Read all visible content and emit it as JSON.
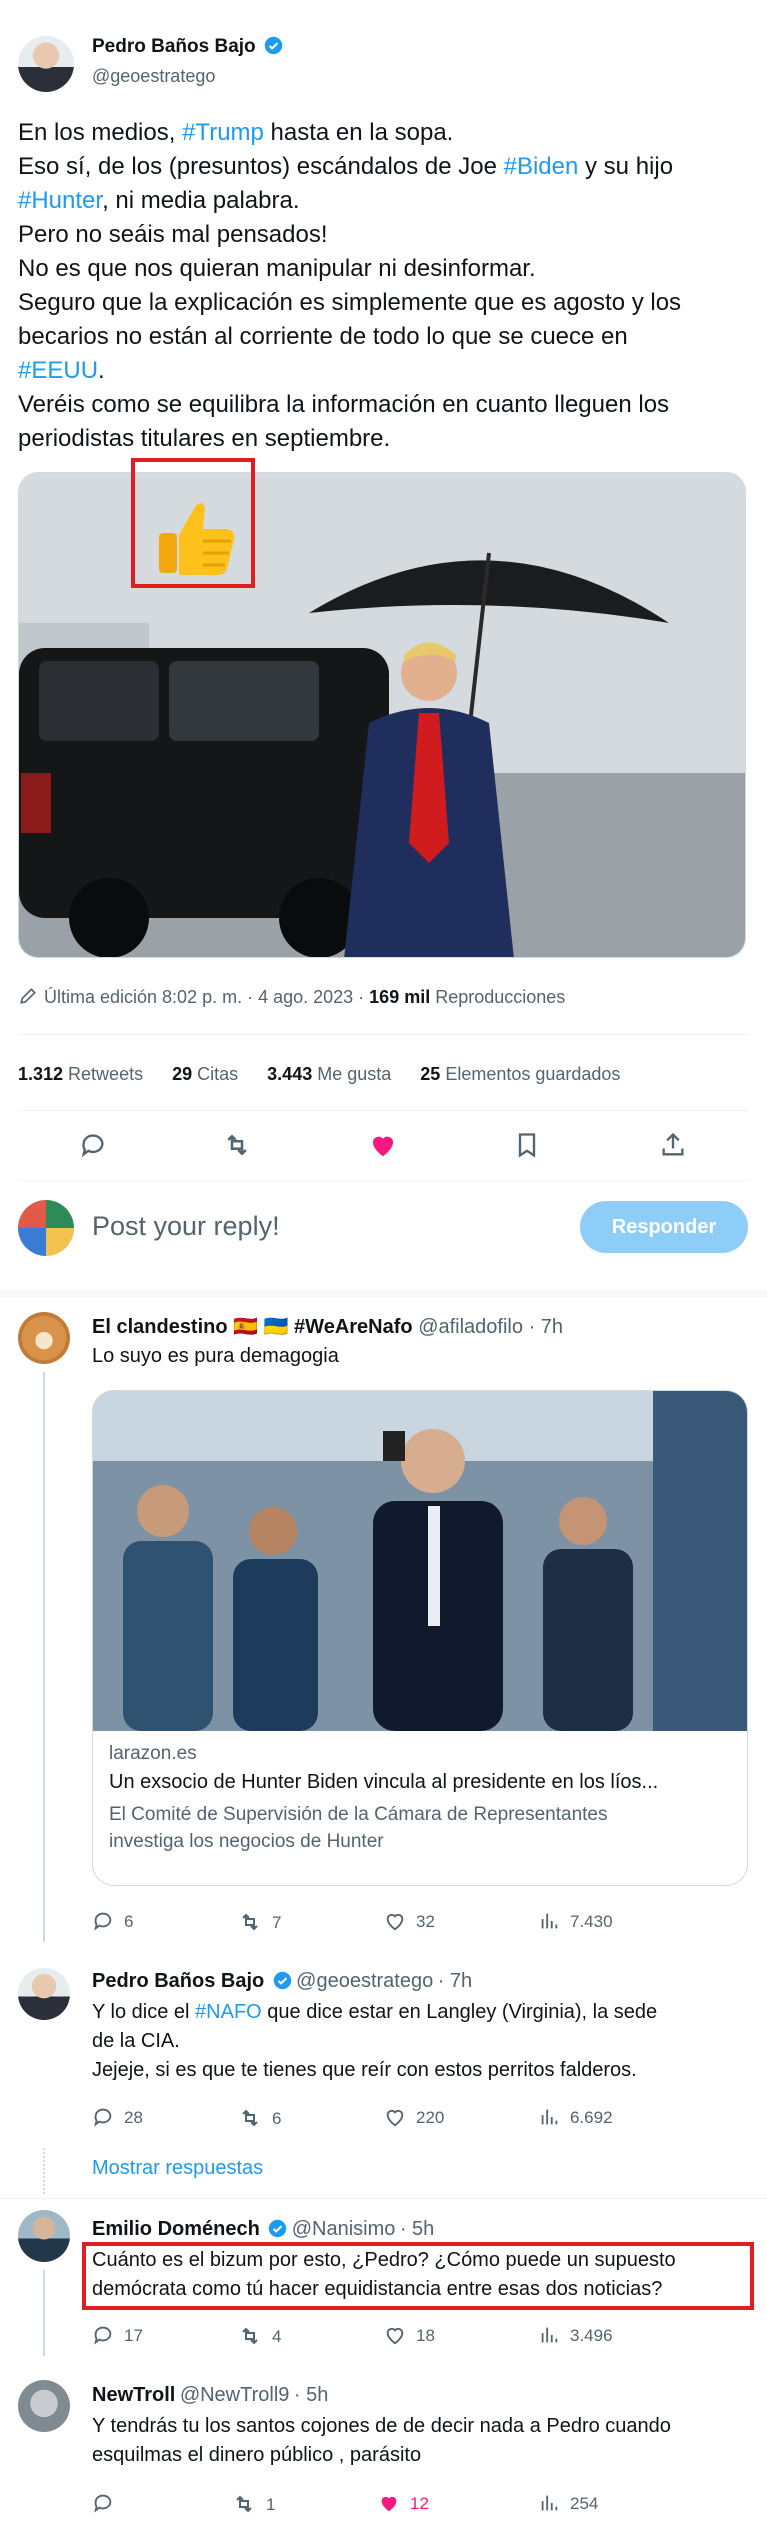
{
  "main_tweet": {
    "author_name": "Pedro Baños Bajo",
    "author_handle": "@geoestratego",
    "text_parts": {
      "l1a": "En los medios, ",
      "l1tag": "#Trump",
      "l1b": " hasta en la sopa.",
      "l2a": "Eso sí, de los (presuntos) escándalos de Joe ",
      "l2tag": "#Biden",
      "l2b": " y su hijo",
      "l3tag": "#Hunter",
      "l3b": ", ni media palabra.",
      "l4": "Pero no seáis mal pensados!",
      "l5": "No es que nos quieran manipular ni desinformar.",
      "l6": "Seguro que la explicación es simplemente que es agosto y los",
      "l7": "becarios no están al corriente de todo lo que se cuece en",
      "l8tag": "#EEUU",
      "l8b": ".",
      "l9": "Veréis como se equilibra la información en cuanto lleguen los",
      "l10": "periodistas titulares en septiembre."
    },
    "edited_label": "Última edición 8:02 p. m. · 4 ago. 2023 · ",
    "views_count": "169 mil",
    "views_label": " Reproducciones",
    "stats": {
      "retweets_count": "1.312",
      "retweets_label": " Retweets",
      "quotes_count": "29",
      "quotes_label": " Citas",
      "likes_count": "3.443",
      "likes_label": " Me gusta",
      "bookmarks_count": "25",
      "bookmarks_label": " Elementos guardados"
    }
  },
  "reply_box": {
    "placeholder": "Post your reply!",
    "button_label": "Responder"
  },
  "replies": [
    {
      "author_name": "El clandestino 🇪🇸 🇺🇦 #WeAreNafo",
      "author_handle": "@afiladofilo",
      "time": "· 7h",
      "text": "Lo suyo es pura demagogia",
      "card": {
        "domain": "larazon.es",
        "title": "Un exsocio de Hunter Biden vincula al presidente en los líos...",
        "desc1": "El Comité de Supervisión de la Cámara de Representantes",
        "desc2": "investiga los negocios de Hunter"
      },
      "replies": "6",
      "retweets": "7",
      "likes": "32",
      "views": "7.430"
    },
    {
      "author_name": "Pedro Baños Bajo",
      "author_handle": "@geoestratego",
      "time": "· 7h",
      "text1a": "Y lo dice el ",
      "text1tag": "#NAFO",
      "text1b": " que dice estar en Langley (Virginia), la sede",
      "text2": "de la CIA.",
      "text3": "Jejeje, si es que te tienes que reír con estos perritos falderos.",
      "replies": "28",
      "retweets": "6",
      "likes": "220",
      "views": "6.692"
    },
    {
      "author_name": "Emilio Doménech",
      "author_handle": "@Nanisimo",
      "time": "· 5h",
      "text1": "Cuánto es el bizum por esto, ¿Pedro? ¿Cómo puede un supuesto",
      "text2": "demócrata como tú hacer equidistancia entre esas dos noticias?",
      "replies": "17",
      "retweets": "4",
      "likes": "18",
      "views": "3.496"
    },
    {
      "author_name": "NewTroll",
      "author_handle": "@NewTroll9",
      "time": "· 5h",
      "text1": "Y tendrás tu los santos cojones de de decir nada a Pedro cuando",
      "text2": "esquilmas el dinero público , parásito",
      "replies": "",
      "retweets": "1",
      "likes": "12",
      "views": "254"
    }
  ],
  "show_replies_label": "Mostrar respuestas",
  "colors": {
    "accent": "#1d9bf0",
    "like_pink": "#f91880",
    "highlight_red": "#e11d21"
  },
  "icons": [
    "verified-badge-icon",
    "thumbs-up-emoji",
    "edit-pencil-icon",
    "reply-icon",
    "retweet-icon",
    "heart-icon",
    "bookmark-icon",
    "share-icon",
    "views-icon"
  ]
}
